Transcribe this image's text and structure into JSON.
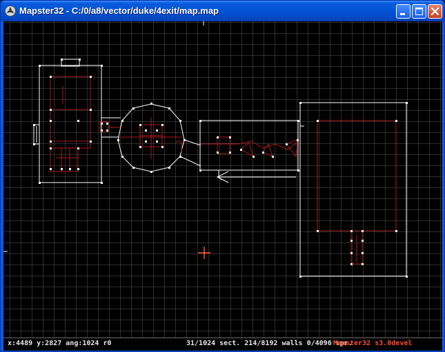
{
  "window": {
    "title": "Mapster32 - C:/0/a8/vector/duke/4exit/map.map",
    "app_icon": "mapster-icon"
  },
  "title_buttons": {
    "minimize": "minimize-icon",
    "maximize": "maximize-icon",
    "close": "close-icon"
  },
  "status": {
    "coords": "x:4489 y:2827 ang:1024 r0",
    "counts": "31/1024 sect. 214/8192 walls 0/4096 spr.",
    "version": "Mapster32 s3.0devel"
  },
  "colors": {
    "title_bar": "#0453d6",
    "canvas_bg": "#000000",
    "grid": "#5a5a5a",
    "wall_white": "#ffffff",
    "wall_red": "#b01818",
    "cursor": "#ff5a2a",
    "version_text": "#ff4a2a"
  }
}
